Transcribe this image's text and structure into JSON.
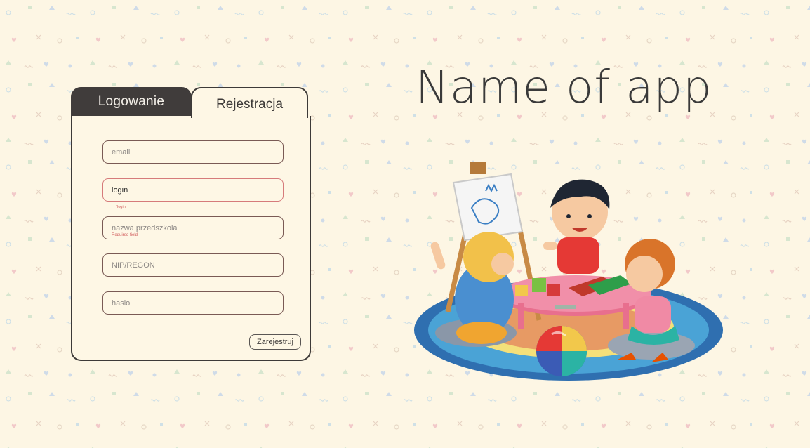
{
  "tabs": {
    "login_label": "Logowanie",
    "register_label": "Rejestracja",
    "active": "register"
  },
  "form": {
    "email": {
      "placeholder": "email",
      "value": ""
    },
    "login": {
      "floating_label": "*login",
      "value": "login",
      "error": "Required field"
    },
    "kindergarten_name": {
      "placeholder": "nazwa przedszkola",
      "value": ""
    },
    "nip_regon": {
      "placeholder": "NIP/REGON",
      "value": ""
    },
    "password": {
      "placeholder": "haslo",
      "value": ""
    },
    "submit_label": "Zarejestruj"
  },
  "app": {
    "title": "Name of app"
  },
  "colors": {
    "background": "#fdf6e4",
    "card": "#fef7e5",
    "dark_tab": "#403c3b",
    "error": "#d05a5a"
  }
}
